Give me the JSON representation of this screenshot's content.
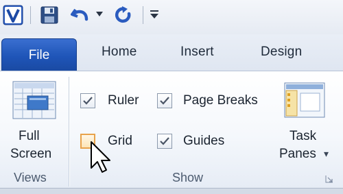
{
  "qat": {
    "visio_icon": "visio-logo-icon",
    "save_icon": "save-icon",
    "undo_icon": "undo-icon",
    "undo_dropdown_icon": "chevron-down-icon",
    "redo_icon": "redo-icon",
    "customize_icon": "customize-qat-icon"
  },
  "tabs": [
    "File",
    "Home",
    "Insert",
    "Design"
  ],
  "ribbon": {
    "views": {
      "full_screen_line1": "Full",
      "full_screen_line2": "Screen",
      "group_label": "Views"
    },
    "show": {
      "checkboxes": [
        {
          "label": "Ruler",
          "checked": true
        },
        {
          "label": "Page Breaks",
          "checked": true
        },
        {
          "label": "Grid",
          "checked": false
        },
        {
          "label": "Guides",
          "checked": true
        }
      ],
      "task_panes_line1": "Task",
      "task_panes_line2": "Panes",
      "task_panes_arrow": "▾",
      "group_label": "Show"
    }
  },
  "colors": {
    "file_tab": "#2a5fc4",
    "hover": "#e8a24a"
  }
}
